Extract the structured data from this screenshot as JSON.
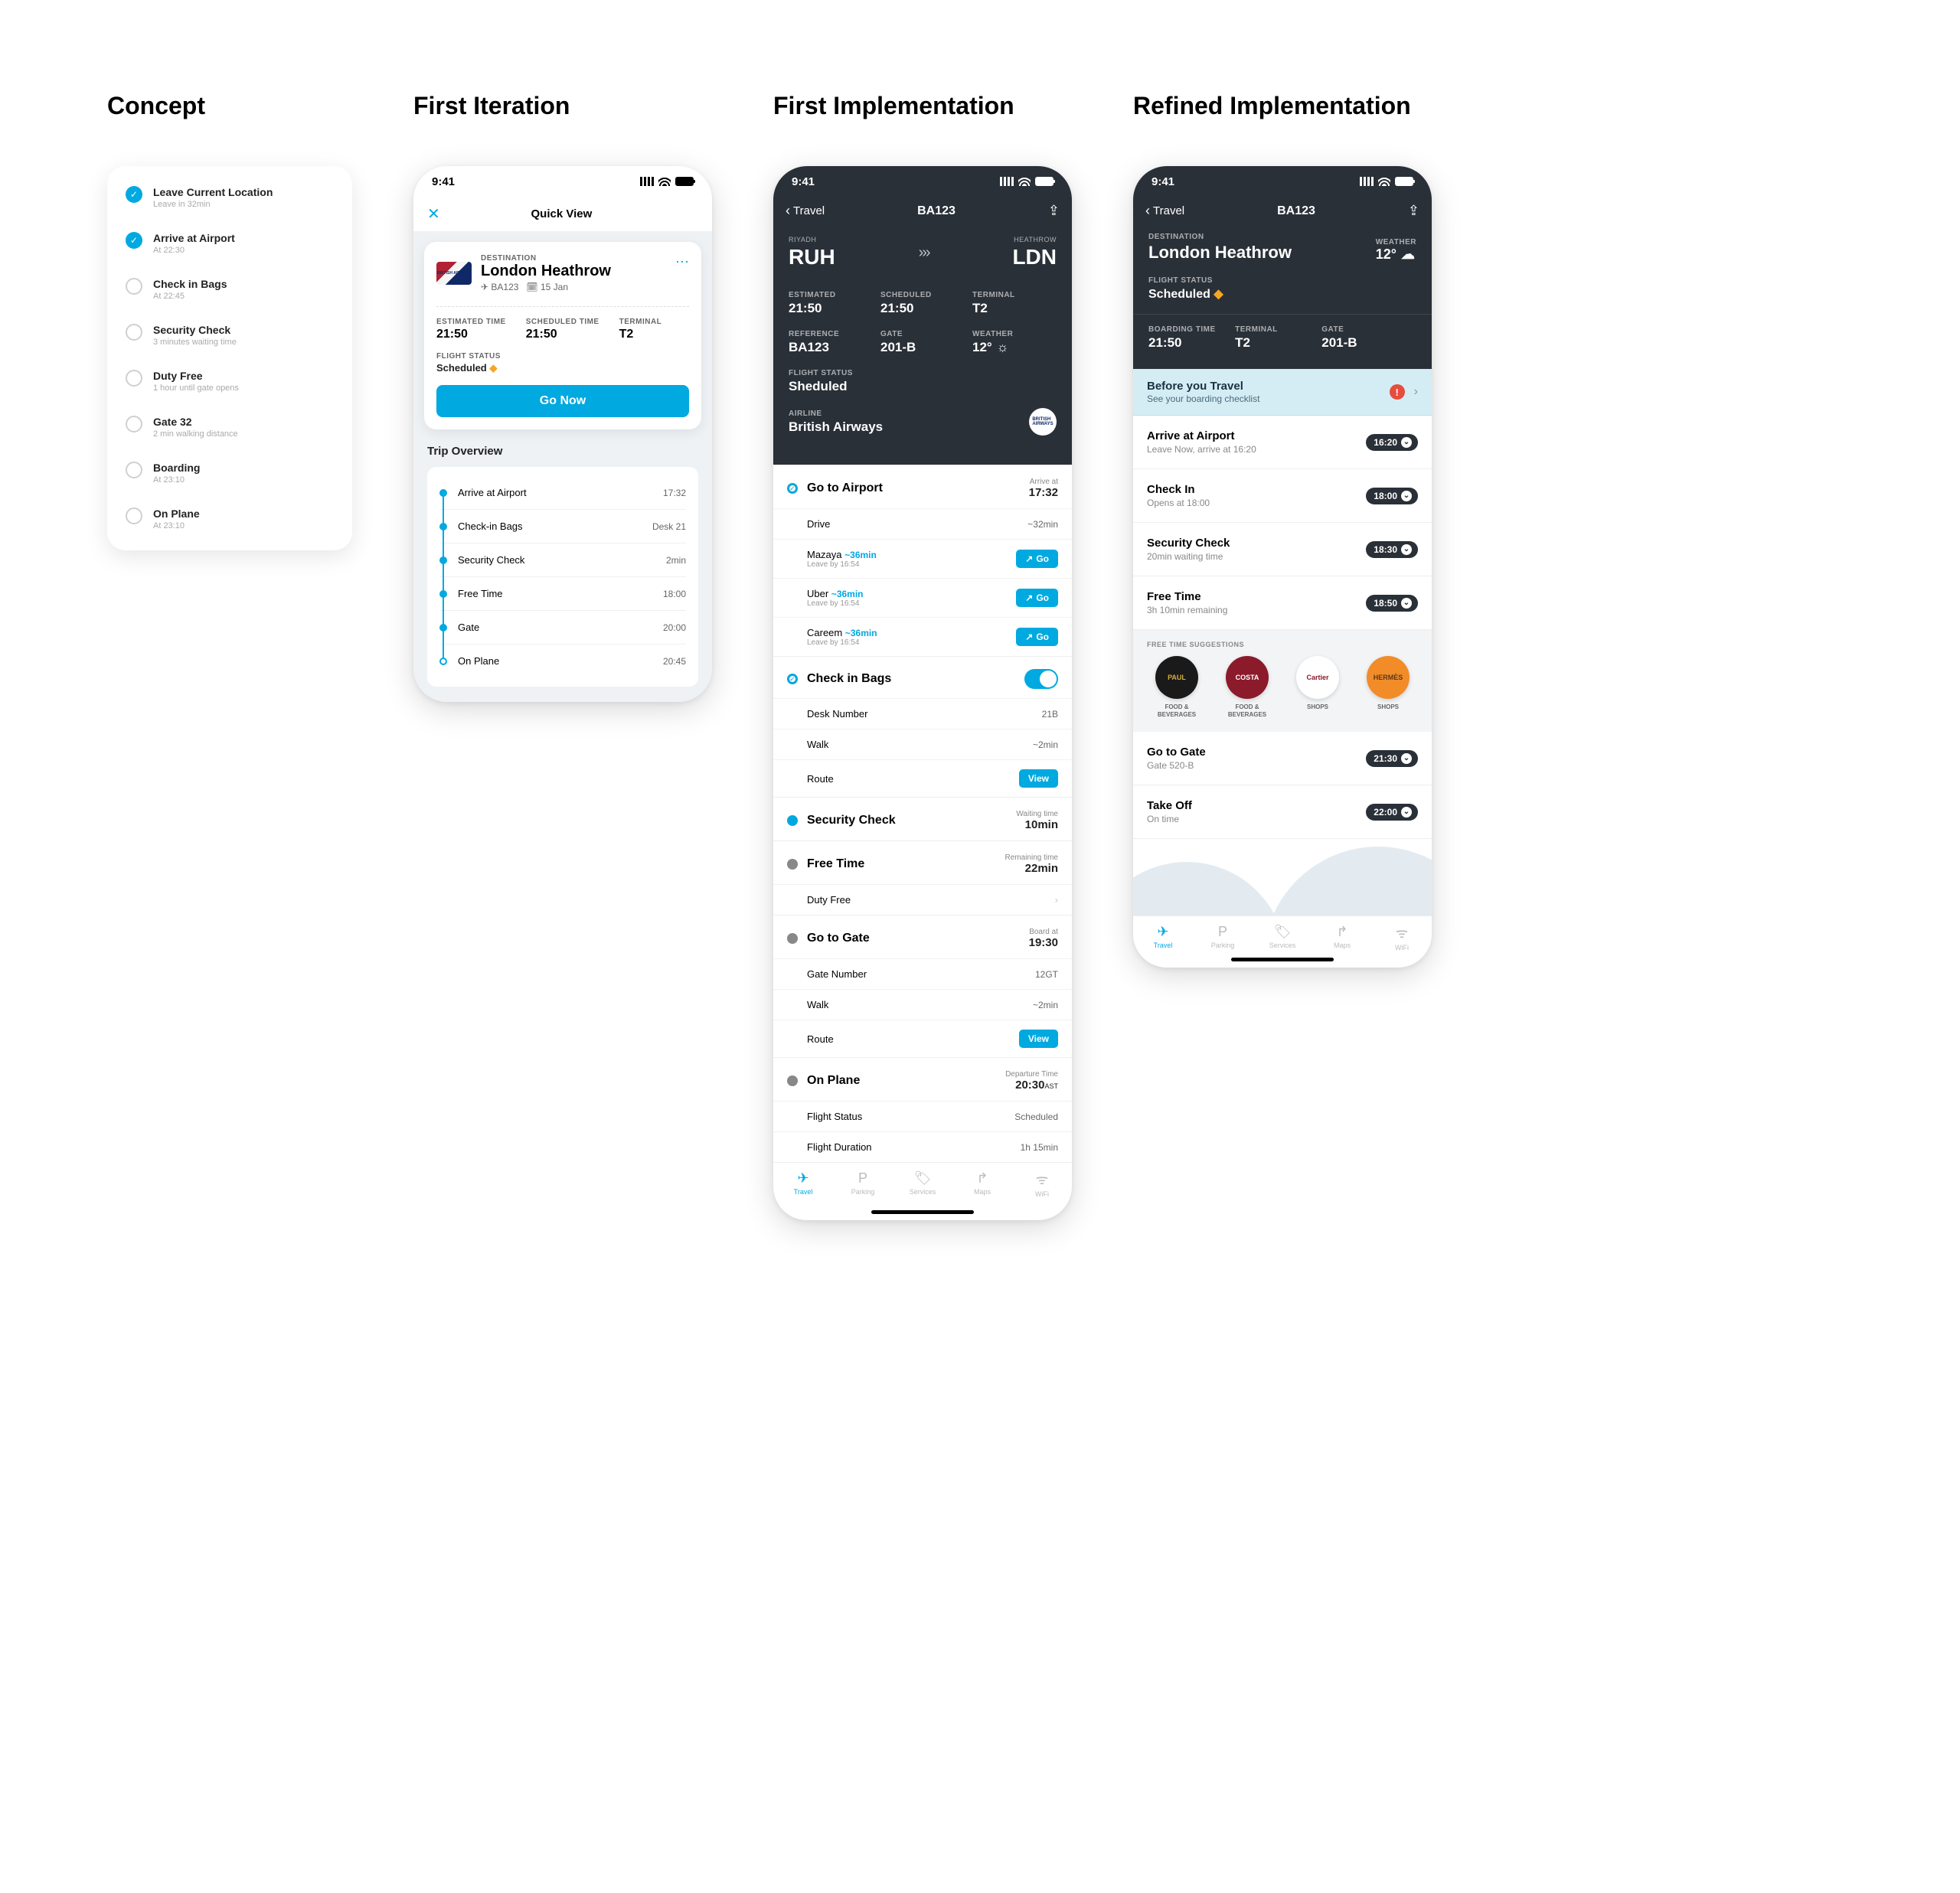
{
  "columns": [
    "Concept",
    "First Iteration",
    "First Implementation",
    "Refined Implementation"
  ],
  "status_time": "9:41",
  "concept": {
    "items": [
      {
        "title": "Leave Current Location",
        "sub": "Leave in 32min",
        "done": true
      },
      {
        "title": "Arrive at Airport",
        "sub": "At 22:30",
        "done": true
      },
      {
        "title": "Check in Bags",
        "sub": "At 22:45",
        "done": false
      },
      {
        "title": "Security Check",
        "sub": "3 minutes waiting time",
        "done": false
      },
      {
        "title": "Duty Free",
        "sub": "1 hour until gate opens",
        "done": false
      },
      {
        "title": "Gate 32",
        "sub": "2 min walking distance",
        "done": false
      },
      {
        "title": "Boarding",
        "sub": "At 23:10",
        "done": false
      },
      {
        "title": "On Plane",
        "sub": "At 23:10",
        "done": false
      }
    ]
  },
  "iter1": {
    "header_title": "Quick View",
    "close": "✕",
    "dest_label": "DESTINATION",
    "dest": "London Heathrow",
    "airline_logo": "BRITISH AIRWAYS",
    "flight": "✈ BA123",
    "date": "🗓 15 Jan",
    "meta": [
      {
        "label": "ESTIMATED TIME",
        "value": "21:50"
      },
      {
        "label": "SCHEDULED TIME",
        "value": "21:50"
      },
      {
        "label": "TERMINAL",
        "value": "T2"
      }
    ],
    "status_label": "FLIGHT STATUS",
    "status": "Scheduled",
    "go_btn": "Go Now",
    "overview_title": "Trip Overview",
    "timeline": [
      {
        "name": "Arrive at Airport",
        "value": "17:32",
        "hollow": false
      },
      {
        "name": "Check-in Bags",
        "value": "Desk 21",
        "hollow": false
      },
      {
        "name": "Security Check",
        "value": "2min",
        "hollow": false
      },
      {
        "name": "Free Time",
        "value": "18:00",
        "hollow": false
      },
      {
        "name": "Gate",
        "value": "20:00",
        "hollow": false
      },
      {
        "name": "On Plane",
        "value": "20:45",
        "hollow": true
      }
    ]
  },
  "impl1": {
    "back": "Travel",
    "title": "BA123",
    "route": {
      "from_city": "RIYADH",
      "from_code": "RUH",
      "to_city": "HEATHROW",
      "to_code": "LDN"
    },
    "info_rows": [
      [
        {
          "label": "ESTIMATED",
          "value": "21:50"
        },
        {
          "label": "SCHEDULED",
          "value": "21:50"
        },
        {
          "label": "TERMINAL",
          "value": "T2"
        }
      ],
      [
        {
          "label": "REFERENCE",
          "value": "BA123"
        },
        {
          "label": "GATE",
          "value": "201-B"
        },
        {
          "label": "WEATHER",
          "value": "12°",
          "icon": "☼"
        }
      ]
    ],
    "status_label": "FLIGHT STATUS",
    "status": "Sheduled",
    "airline_label": "AIRLINE",
    "airline": "British Airways",
    "sections": [
      {
        "name": "Go to Airport",
        "dot": "blue-hollow-check",
        "meta_label": "Arrive at",
        "meta_value": "17:32",
        "subs": [
          {
            "name": "Drive",
            "right_text": "~32min"
          },
          {
            "name": "Mazaya",
            "est": "~36min",
            "leaveby": "Leave by 16:54",
            "btn": "Go",
            "btn_icon": "↗"
          },
          {
            "name": "Uber",
            "est": "~36min",
            "leaveby": "Leave by 16:54",
            "btn": "Go",
            "btn_icon": "↗"
          },
          {
            "name": "Careem",
            "est": "~36min",
            "leaveby": "Leave by 16:54",
            "btn": "Go",
            "btn_icon": "↗"
          }
        ]
      },
      {
        "name": "Check in Bags",
        "dot": "blue-hollow-check",
        "toggle": true,
        "subs": [
          {
            "name": "Desk Number",
            "right_text": "21B"
          },
          {
            "name": "Walk",
            "right_text": "~2min"
          },
          {
            "name": "Route",
            "btn": "View"
          }
        ]
      },
      {
        "name": "Security Check",
        "dot": "blue-filled",
        "meta_label": "Waiting time",
        "meta_value": "10min",
        "subs": []
      },
      {
        "name": "Free Time",
        "dot": "grey",
        "meta_label": "Remaining time",
        "meta_value": "22min",
        "subs": [
          {
            "name": "Duty Free",
            "chev": true
          }
        ]
      },
      {
        "name": "Go to Gate",
        "dot": "grey",
        "meta_label": "Board at",
        "meta_value": "19:30",
        "subs": [
          {
            "name": "Gate Number",
            "right_text": "12GT"
          },
          {
            "name": "Walk",
            "right_text": "~2min"
          },
          {
            "name": "Route",
            "btn": "View"
          }
        ]
      },
      {
        "name": "On Plane",
        "dot": "grey",
        "meta_label": "Departure Time",
        "meta_value": "20:30",
        "meta_suffix": "AST",
        "subs": [
          {
            "name": "Flight Status",
            "right_text": "Scheduled"
          },
          {
            "name": "Flight Duration",
            "right_text": "1h 15min"
          }
        ]
      }
    ],
    "tabs": [
      {
        "label": "Travel",
        "icon": "✈",
        "active": true
      },
      {
        "label": "Parking",
        "icon": "P",
        "active": false
      },
      {
        "label": "Services",
        "icon": "🏷",
        "active": false
      },
      {
        "label": "Maps",
        "icon": "↱",
        "active": false
      },
      {
        "label": "WiFi",
        "icon": "ᯤ",
        "active": false
      }
    ]
  },
  "impl2": {
    "back": "Travel",
    "title": "BA123",
    "dest_label": "DESTINATION",
    "dest": "London Heathrow",
    "weather_label": "WEATHER",
    "weather": "12°",
    "weather_icon": "☁",
    "status_label": "FLIGHT STATUS",
    "status": "Scheduled",
    "meta": [
      {
        "label": "BOARDING TIME",
        "value": "21:50"
      },
      {
        "label": "TERMINAL",
        "value": "T2"
      },
      {
        "label": "GATE",
        "value": "201-B"
      }
    ],
    "banner": {
      "title": "Before you Travel",
      "sub": "See your boarding checklist"
    },
    "steps": [
      {
        "title": "Arrive at Airport",
        "sub": "Leave Now, arrive at 16:20",
        "pill": "16:20"
      },
      {
        "title": "Check In",
        "sub": "Opens at 18:00",
        "pill": "18:00"
      },
      {
        "title": "Security Check",
        "sub": "20min waiting time",
        "pill": "18:30"
      },
      {
        "title": "Free Time",
        "sub": "3h 10min remaining",
        "pill": "18:50"
      }
    ],
    "sugg_title": "FREE TIME SUGGESTIONS",
    "sugg": [
      {
        "name": "PAUL",
        "cat": "FOOD & BEVERAGES",
        "bg": "#1a1a1a",
        "fg": "#d4af37"
      },
      {
        "name": "COSTA",
        "cat": "FOOD & BEVERAGES",
        "bg": "#8b1a2b",
        "fg": "#fff"
      },
      {
        "name": "Cartier",
        "cat": "SHOPS",
        "bg": "#fff",
        "fg": "#8b1a2b"
      },
      {
        "name": "HERMÈS",
        "cat": "SHOPS",
        "bg": "#f28c28",
        "fg": "#5a3a1a"
      }
    ],
    "steps2": [
      {
        "title": "Go to Gate",
        "sub": "Gate 520-B",
        "pill": "21:30"
      },
      {
        "title": "Take Off",
        "sub": "On time",
        "pill": "22:00"
      }
    ],
    "tabs": [
      {
        "label": "Travel",
        "icon": "✈",
        "active": true
      },
      {
        "label": "Parking",
        "icon": "P",
        "active": false
      },
      {
        "label": "Services",
        "icon": "🏷",
        "active": false
      },
      {
        "label": "Maps",
        "icon": "↱",
        "active": false
      },
      {
        "label": "WiFi",
        "icon": "ᯤ",
        "active": false
      }
    ]
  }
}
